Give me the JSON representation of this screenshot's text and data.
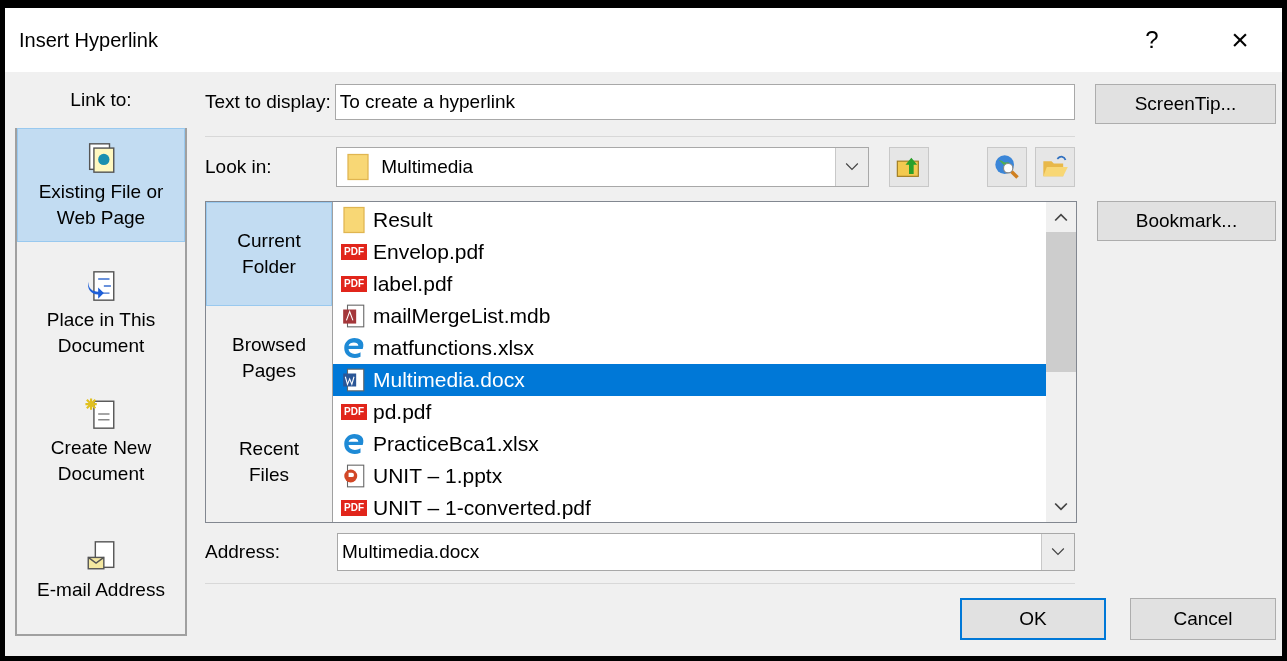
{
  "window": {
    "title": "Insert Hyperlink",
    "help": "?",
    "close": "×"
  },
  "link_to": {
    "label": "Link to:",
    "items": [
      {
        "kind": "file",
        "lines": [
          "Existing File or",
          "Web Page"
        ],
        "selected": true
      },
      {
        "kind": "place",
        "lines": [
          "Place in This",
          "Document"
        ],
        "selected": false
      },
      {
        "kind": "new",
        "lines": [
          "Create New",
          "Document"
        ],
        "selected": false
      },
      {
        "kind": "email",
        "lines": [
          "E-mail Address"
        ],
        "selected": false
      }
    ]
  },
  "text_to_display": {
    "label": "Text to display:",
    "value": "To create a hyperlink"
  },
  "screentip_button": "ScreenTip...",
  "look_in": {
    "label": "Look in:",
    "value": "Multimedia"
  },
  "nav": [
    {
      "lines": [
        "Current",
        "Folder"
      ],
      "selected": true
    },
    {
      "lines": [
        "Browsed",
        "Pages"
      ],
      "selected": false
    },
    {
      "lines": [
        "Recent",
        "Files"
      ],
      "selected": false
    }
  ],
  "files": [
    {
      "kind": "folder",
      "name": "Result",
      "selected": false
    },
    {
      "kind": "pdf",
      "badge": "PDF",
      "name": "Envelop.pdf",
      "selected": false
    },
    {
      "kind": "pdf",
      "badge": "PDF",
      "name": "label.pdf",
      "selected": false
    },
    {
      "kind": "access",
      "name": "mailMergeList.mdb",
      "selected": false
    },
    {
      "kind": "web",
      "name": "matfunctions.xlsx",
      "selected": false
    },
    {
      "kind": "word",
      "name": "Multimedia.docx",
      "selected": true
    },
    {
      "kind": "pdf",
      "badge": "PDF",
      "name": "pd.pdf",
      "selected": false
    },
    {
      "kind": "web",
      "name": "PracticeBca1.xlsx",
      "selected": false
    },
    {
      "kind": "powerpoint",
      "name": "UNIT – 1.pptx",
      "selected": false
    },
    {
      "kind": "pdf",
      "badge": "PDF",
      "name": "UNIT – 1-converted.pdf",
      "selected": false
    }
  ],
  "bookmark_button": "Bookmark...",
  "address": {
    "label": "Address:",
    "value": "Multimedia.docx"
  },
  "buttons": [
    "OK",
    "Cancel"
  ]
}
